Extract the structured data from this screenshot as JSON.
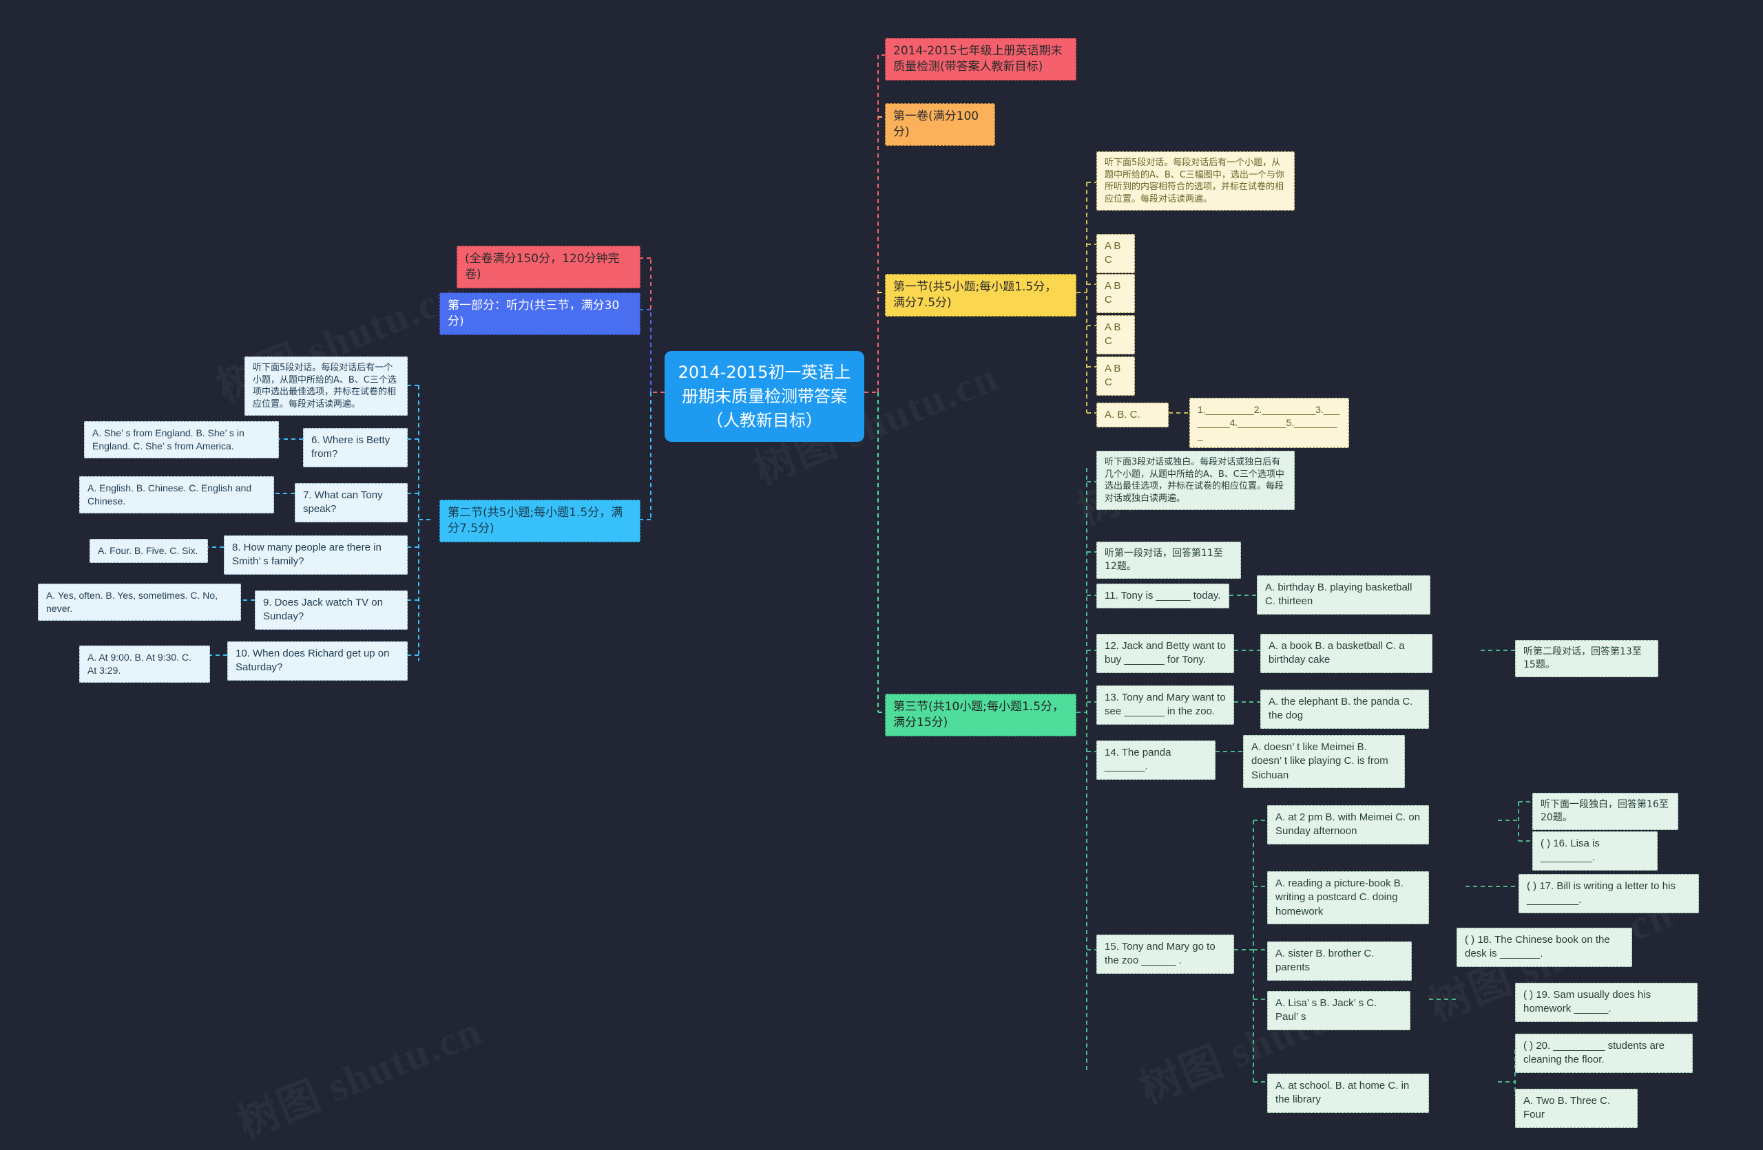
{
  "meta": {
    "background_color": "#222634",
    "root_color": "#1e9bf0",
    "watermark_text": "树图 shutu.cn"
  },
  "root": {
    "label": "2014-2015初一英语上册期末质量检测带答案（人教新目标）"
  },
  "right_branch": {
    "title": "2014-2015七年级上册英语期末质量检测(带答案人教新目标)",
    "paper_one": "第一卷(满分100分)",
    "section1": {
      "label": "第一节(共5小题;每小题1.5分，满分7.5分)",
      "instruction": "听下面5段对话。每段对话后有一个小题，从题中所给的A、B、C三幅图中，选出一个与你所听到的内容相符合的选项，并标在试卷的相应位置。每段对话读两遍。",
      "options": [
        "A B C",
        "A B C",
        "A B C",
        "A B C"
      ],
      "option_last": "A. B. C.",
      "blank_row": "1._________2.__________3._________4._________5._________"
    },
    "section3": {
      "label": "第三节(共10小题;每小题1.5分，满分15分)",
      "instruction": "听下面3段对话或独白。每段对话或独白后有几个小题，从题中所给的A、B、C三个选项中选出最佳选项，并标在试卷的相应位置。每段对话或独白读两遍。",
      "cue1": "听第一段对话，回答第11至12题。",
      "cue2": "听第二段对话，回答第13至15题。",
      "cue3": "听下面一段独白，回答第16至20题。",
      "q11": "11. Tony is ______ today.",
      "a11": "A. birthday B. playing basketball C. thirteen",
      "q12": "12. Jack and Betty want to buy _______ for Tony.",
      "a12": "A. a book B. a basketball C. a birthday cake",
      "q13": "13. Tony and Mary want to see _______ in the zoo.",
      "a13": "A. the elephant B. the panda C. the dog",
      "q14": "14. The panda _______.",
      "a14": "A. doesn’ t like Meimei B. doesn’ t like playing C. is from Sichuan",
      "q15": "15. Tony and Mary go to the zoo ______ .",
      "a15a": "A. at 2 pm B. with Meimei C. on Sunday afternoon",
      "a15b": "A. reading a picture-book B. writing a postcard C. doing homework",
      "a15c": "A. sister B. brother C. parents",
      "a15d": "A. Lisa’ s B. Jack’ s C. Paul’ s",
      "a15e": "A. at school. B. at home C. in the library",
      "q16": "( ) 16. Lisa is _________.",
      "q17": "( ) 17. Bill is writing a letter to his _________.",
      "q18": "( ) 18. The Chinese book on the desk is _______.",
      "q19": "( ) 19. Sam usually does his homework ______.",
      "q20": "( ) 20. _________ students are cleaning the floor.",
      "a20": "A. Two B. Three C. Four"
    }
  },
  "left_branch": {
    "full_score": "(全卷满分150分，120分钟完卷)",
    "part1": "第一部分：听力(共三节，满分30分)",
    "section2": {
      "label": "第二节(共5小题;每小题1.5分，满分7.5分)",
      "instruction": "听下面5段对话。每段对话后有一个小题，从题中所给的A、B、C三个选项中选出最佳选项，并标在试卷的相应位置。每段对话读两遍。",
      "items": [
        {
          "question": "6. Where is Betty from?",
          "answer": "A. She’ s from England. B. She’ s in England. C. She’ s from America."
        },
        {
          "question": "7. What can Tony speak?",
          "answer": "A. English. B. Chinese. C. English and Chinese."
        },
        {
          "question": "8. How many people are there in Smith’ s family?",
          "answer": "A. Four. B. Five. C. Six."
        },
        {
          "question": "9. Does Jack watch TV on Sunday?",
          "answer": "A. Yes, often. B. Yes, sometimes. C. No, never."
        },
        {
          "question": "10. When does Richard get up on Saturday?",
          "answer": "A. At 9:00. B. At 9:30. C. At 3:29."
        }
      ]
    }
  }
}
